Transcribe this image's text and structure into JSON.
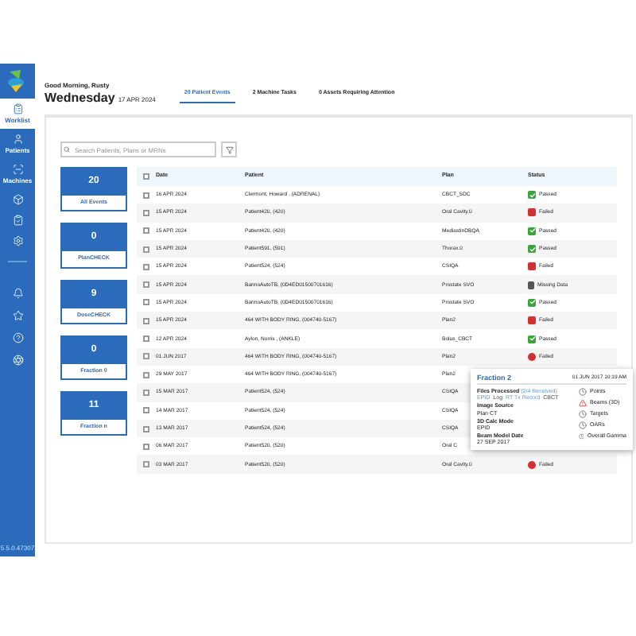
{
  "sidebar": {
    "items": [
      {
        "label": "Worklist",
        "selected": true
      },
      {
        "label": "Patients",
        "selected": false
      },
      {
        "label": "Machines",
        "selected": false
      },
      {
        "selected": false
      },
      {
        "selected": false
      },
      {
        "selected": false
      }
    ],
    "version": "5.5.0.47307"
  },
  "header": {
    "greeting": "Good Morning, Rusty",
    "day": "Wednesday",
    "date": "17 APR 2024"
  },
  "tabs": [
    {
      "label": "20 Patient Events",
      "selected": true
    },
    {
      "label": "2 Machine Tasks",
      "selected": false
    },
    {
      "label": "0 Assets Requiring Attention",
      "selected": false
    }
  ],
  "search": {
    "placeholder": "Search Patients, Plans or MRNs"
  },
  "summary_cards": [
    {
      "count": "20",
      "label": "All Events"
    },
    {
      "count": "0",
      "label": "PlanCHECK"
    },
    {
      "count": "9",
      "label": "DoseCHECK"
    },
    {
      "count": "0",
      "label": "Fraction 0"
    },
    {
      "count": "11",
      "label": "Fraction n"
    }
  ],
  "table": {
    "select_all_checked": false,
    "columns": [
      "Date",
      "Patient",
      "Plan",
      "Status"
    ],
    "rows": [
      {
        "checked": false,
        "date": "16 APR 2024",
        "patient": "Clermont, Howard , (ADRENAL)",
        "plan": "CBCT_SDC",
        "status": {
          "label": "Passed",
          "kind": "passed"
        }
      },
      {
        "checked": false,
        "date": "15 APR 2024",
        "patient": "Patient420, (420)",
        "plan": "Oral Cavity.0",
        "status": {
          "label": "Failed",
          "kind": "failed"
        }
      },
      {
        "checked": false,
        "date": "15 APR 2024",
        "patient": "Patient420, (420)",
        "plan": "MediastinDBQA",
        "status": {
          "label": "Passed",
          "kind": "passed"
        }
      },
      {
        "checked": false,
        "date": "15 APR 2024",
        "patient": "Patient591, (591)",
        "plan": "Thorax.0",
        "status": {
          "label": "Passed",
          "kind": "passed"
        }
      },
      {
        "checked": false,
        "date": "15 APR 2024",
        "patient": "Patient524, (524)",
        "plan": "CSIQA",
        "status": {
          "label": "Failed",
          "kind": "failed"
        }
      },
      {
        "checked": false,
        "date": "15 APR 2024",
        "patient": "BannoAutoTB, (0D4ED01500701616)",
        "plan": "Prostate SVO",
        "status": {
          "label": "Missing Data",
          "kind": "missing"
        }
      },
      {
        "checked": false,
        "date": "15 APR 2024",
        "patient": "BannoAutoTB, (0D4ED01500701616)",
        "plan": "Prostate SVO",
        "status": {
          "label": "Passed",
          "kind": "passed"
        }
      },
      {
        "checked": false,
        "date": "15 APR 2024",
        "patient": "464 WITH BODY RING, (004740-5167)",
        "plan": "Plan2",
        "status": {
          "label": "Failed",
          "kind": "failed"
        }
      },
      {
        "checked": false,
        "date": "12 APR 2024",
        "patient": "Aylon, Norris , (ANKLE)",
        "plan": "Bolus_CBCT",
        "status": {
          "label": "Passed",
          "kind": "passed"
        }
      },
      {
        "checked": false,
        "date": "01 JUN 2017",
        "patient": "464 WITH BODY RING, (004740-5167)",
        "plan": "Plan2",
        "status": {
          "label": "Failed",
          "kind": "alert"
        }
      },
      {
        "checked": false,
        "date": "29 MAY 2017",
        "patient": "464 WITH BODY RING, (004740-5167)",
        "plan": "Plan2"
      },
      {
        "checked": false,
        "date": "15 MAR 2017",
        "patient": "Patient524, (524)",
        "plan": "CSIQA"
      },
      {
        "checked": false,
        "date": "14 MAR 2017",
        "patient": "Patient524, (524)",
        "plan": "CSIQA"
      },
      {
        "checked": false,
        "date": "13 MAR 2017",
        "patient": "Patient524, (524)",
        "plan": "CSIQA"
      },
      {
        "checked": false,
        "date": "06 MAR 2017",
        "patient": "Patient520, (520)",
        "plan": "Oral C"
      },
      {
        "checked": false,
        "date": "03 MAR 2017",
        "patient": "Patient520, (520)",
        "plan": "Oral Cavity.0",
        "status": {
          "label": "Failed",
          "kind": "alert"
        }
      }
    ]
  },
  "popover": {
    "title": "Fraction 2",
    "timestamp": "01 JUN 2017 10:19 AM",
    "fields": [
      {
        "label": "Files Processed",
        "note": "(2/4 Received)",
        "files": [
          {
            "label": "EPID",
            "received": true
          },
          {
            "label": "Log",
            "received": false
          },
          {
            "label": "RT Tx Record",
            "received": true
          },
          {
            "label": "CBCT",
            "received": false
          }
        ]
      },
      {
        "label": "Image Source",
        "value": "Plan CT"
      },
      {
        "label": "3D Calc Mode",
        "value": "EPID"
      },
      {
        "label": "Beam Model Date",
        "value": "27 SEP 2017"
      }
    ],
    "checks": [
      {
        "label": "Points",
        "kind": "pending"
      },
      {
        "label": "Beams (3D)",
        "kind": "error"
      },
      {
        "label": "Targets",
        "kind": "pending"
      },
      {
        "label": "OARs",
        "kind": "pending"
      },
      {
        "label": "Overall Gamma",
        "kind": "pending"
      }
    ]
  }
}
